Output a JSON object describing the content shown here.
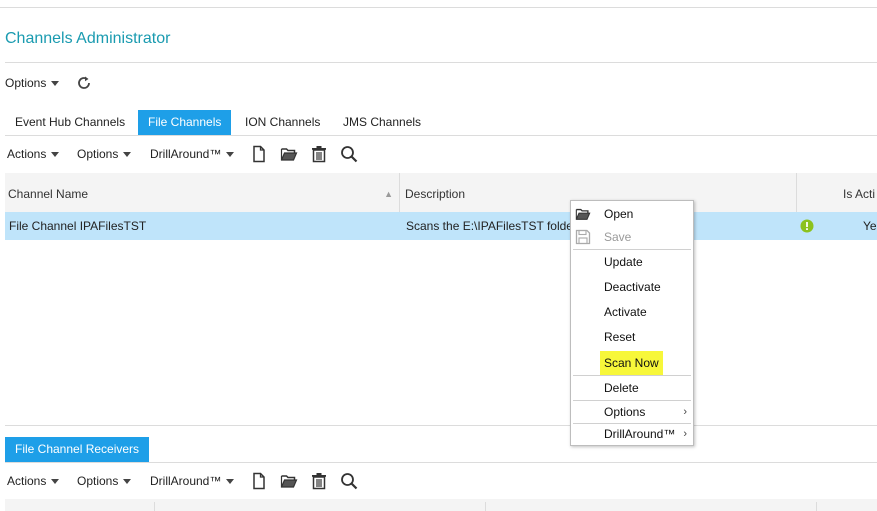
{
  "page": {
    "title": "Channels Administrator"
  },
  "top_toolbar": {
    "options_label": "Options"
  },
  "tabs": [
    {
      "label": "Event Hub Channels",
      "active": false
    },
    {
      "label": "File Channels",
      "active": true
    },
    {
      "label": "ION Channels",
      "active": false
    },
    {
      "label": "JMS Channels",
      "active": false
    }
  ],
  "grid_toolbar": {
    "actions_label": "Actions",
    "options_label": "Options",
    "drill_label": "DrillAround™"
  },
  "table": {
    "columns": [
      "Channel Name",
      "Description",
      "Is Acti"
    ],
    "rows": [
      {
        "name": "File Channel IPAFilesTST",
        "description": "Scans the E:\\IPAFilesTST folde",
        "active": "Ye"
      }
    ]
  },
  "context_menu": {
    "items": [
      {
        "label": "Open",
        "icon": "folder-open-icon",
        "disabled": false
      },
      {
        "label": "Save",
        "icon": "save-icon",
        "disabled": true
      },
      {
        "label": "Update"
      },
      {
        "label": "Deactivate"
      },
      {
        "label": "Activate"
      },
      {
        "label": "Reset"
      },
      {
        "label": "Scan Now",
        "highlighted": true
      },
      {
        "label": "Delete"
      },
      {
        "label": "Options",
        "submenu": true
      },
      {
        "label": "DrillAround™",
        "submenu": true
      }
    ],
    "submenu_arrow": "›"
  },
  "receivers": {
    "tab_label": "File Channel Receivers",
    "toolbar": {
      "actions_label": "Actions",
      "options_label": "Options",
      "drill_label": "DrillAround™"
    }
  },
  "colors": {
    "accent": "#1e9fe8",
    "title": "#1a9bb0",
    "selected_row": "#bfe4fa",
    "highlight": "#f7f73a",
    "status_ok": "#8cc21e"
  }
}
